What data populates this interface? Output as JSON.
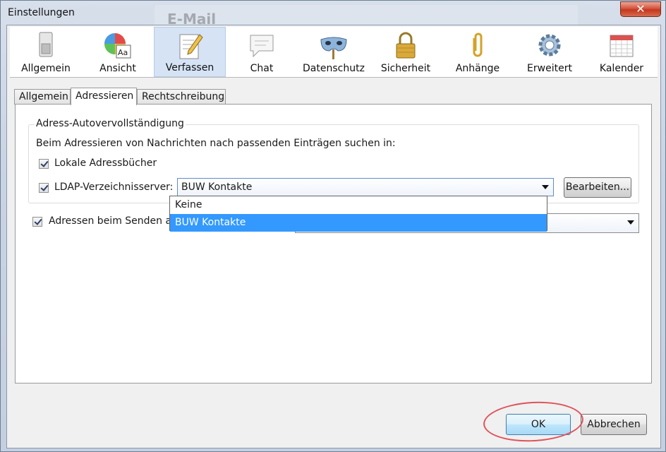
{
  "window": {
    "title": "Einstellungen",
    "background_title": "E-Mail",
    "close_label": "✕"
  },
  "toolbar": {
    "items": [
      {
        "label": "Allgemein",
        "icon": "switch-icon"
      },
      {
        "label": "Ansicht",
        "icon": "palette-icon"
      },
      {
        "label": "Verfassen",
        "icon": "compose-icon"
      },
      {
        "label": "Chat",
        "icon": "chat-bubble-icon"
      },
      {
        "label": "Datenschutz",
        "icon": "mask-icon"
      },
      {
        "label": "Sicherheit",
        "icon": "padlock-icon"
      },
      {
        "label": "Anhänge",
        "icon": "paperclip-icon"
      },
      {
        "label": "Erweitert",
        "icon": "gear-icon"
      },
      {
        "label": "Kalender",
        "icon": "calendar-icon"
      }
    ],
    "selected": "Verfassen"
  },
  "subtabs": [
    {
      "label": "Allgemein"
    },
    {
      "label": "Adressieren"
    },
    {
      "label": "Rechtschreibung"
    }
  ],
  "addressing": {
    "group_title": "Adress-Autovervollständigung",
    "description": "Beim Adressieren von Nachrichten nach passenden Einträgen suchen in:",
    "local_books_label": "Lokale Adressbücher",
    "ldap_label": "LDAP-Verzeichnisserver:",
    "ldap_selected": "BUW Kontakte",
    "edit_button": "Bearbeiten...",
    "auto_add_label": "Adressen beim Senden auto",
    "dropdown_options": [
      "Keine",
      "BUW Kontakte"
    ],
    "dropdown_highlighted": "BUW Kontakte"
  },
  "footer": {
    "ok_label": "OK",
    "cancel_label": "Abbrechen"
  },
  "colors": {
    "selection": "#3399ff",
    "annotation_ring": "#e0525a",
    "close_red": "#c2371f"
  }
}
